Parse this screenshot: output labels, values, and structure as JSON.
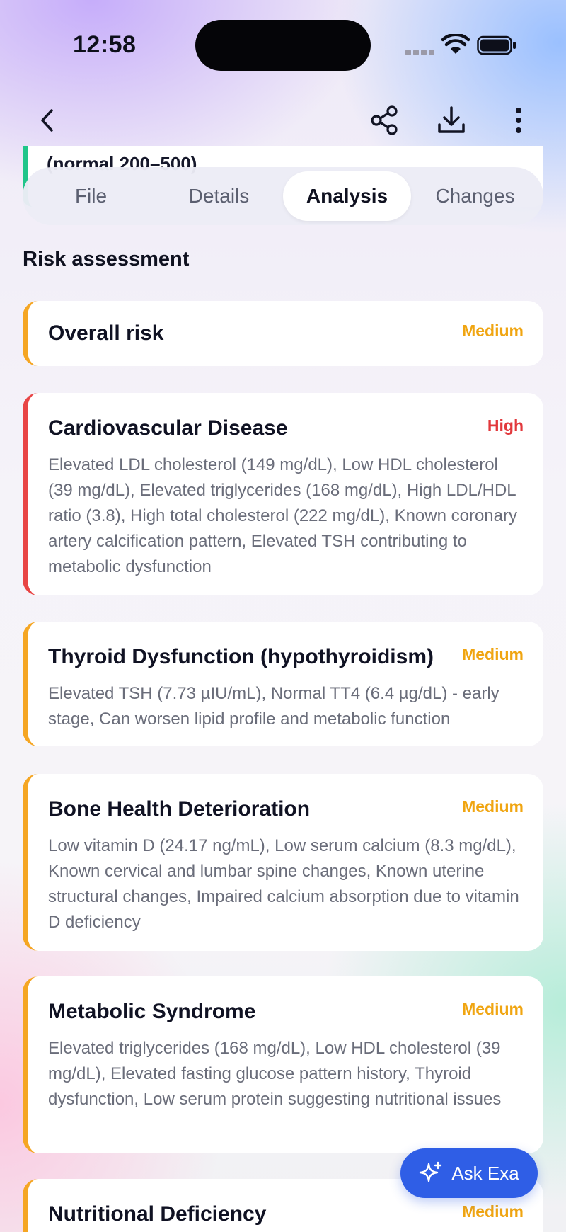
{
  "status_bar": {
    "time": "12:58"
  },
  "peek_card": {
    "text": "(normal 200–500)"
  },
  "tabs": [
    {
      "label": "File"
    },
    {
      "label": "Details"
    },
    {
      "label": "Analysis"
    },
    {
      "label": "Changes"
    }
  ],
  "active_tab": "Analysis",
  "section_title": "Risk assessment",
  "risks": [
    {
      "name": "Overall risk",
      "level": "Medium",
      "description": ""
    },
    {
      "name": "Cardiovascular Disease",
      "level": "High",
      "description": "Elevated LDL cholesterol (149 mg/dL), Low HDL cholesterol (39 mg/dL), Elevated triglycerides (168 mg/dL), High LDL/HDL ratio (3.8), High total cholesterol (222 mg/dL), Known coronary artery calcification pattern, Elevated TSH contributing to metabolic dysfunction"
    },
    {
      "name": "Thyroid Dysfunction (hypothyroidism)",
      "level": "Medium",
      "description": "Elevated TSH (7.73 µIU/mL), Normal TT4 (6.4 µg/dL) - early stage, Can worsen lipid profile and metabolic function"
    },
    {
      "name": "Bone Health Deterioration",
      "level": "Medium",
      "description": "Low vitamin D (24.17 ng/mL), Low serum calcium (8.3 mg/dL), Known cervical and lumbar spine changes, Known uterine structural changes, Impaired calcium absorption due to vitamin D deficiency"
    },
    {
      "name": "Metabolic Syndrome",
      "level": "Medium",
      "description": "Elevated triglycerides (168 mg/dL), Low HDL cholesterol (39 mg/dL), Elevated fasting glucose pattern history, Thyroid dysfunction, Low serum protein suggesting nutritional issues"
    },
    {
      "name": "Nutritional Deficiency",
      "level": "Medium",
      "description": ""
    }
  ],
  "ask_button": {
    "label": "Ask Exa"
  },
  "colors": {
    "medium": "#f0a511",
    "high": "#e2383c",
    "accent": "#2f5ee6",
    "peek_border": "#20c58a"
  },
  "icons": [
    "back-chevron-icon",
    "share-icon",
    "download-icon",
    "more-vertical-icon",
    "sparkle-icon",
    "wifi-icon",
    "battery-icon"
  ]
}
